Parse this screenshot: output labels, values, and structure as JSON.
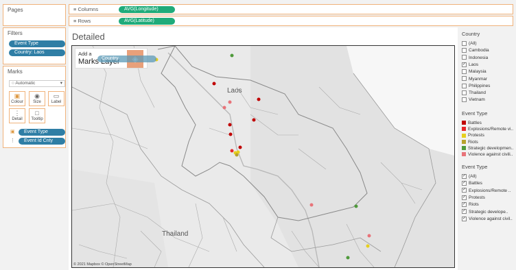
{
  "shelves": {
    "pages_label": "Pages",
    "columns_label": "Columns",
    "columns_pill": "AVG(Longitude)",
    "rows_label": "Rows",
    "rows_pill": "AVG(Latitude)"
  },
  "filters": {
    "title": "Filters",
    "items": [
      "Event Type",
      "Country: Laos"
    ]
  },
  "marks": {
    "title": "Marks",
    "type_value": "Automatic",
    "buttons": [
      "Colour",
      "Size",
      "Label",
      "Detail",
      "Tooltip"
    ],
    "fields": [
      "Event Type",
      "Event Id Cnty"
    ]
  },
  "view": {
    "title": "Detailed",
    "add_layer_line1": "Add a",
    "add_layer_line2": "Marks Layer",
    "drag_pill": "Country",
    "label_laos": "Laos",
    "label_thailand": "Thailand",
    "attribution": "© 2021 Mapbox © OpenStreetMap"
  },
  "country_filter": {
    "title": "Country",
    "items": [
      {
        "label": "(All)",
        "checked": false
      },
      {
        "label": "Cambodia",
        "checked": false
      },
      {
        "label": "Indonesia",
        "checked": false
      },
      {
        "label": "Laos",
        "checked": true
      },
      {
        "label": "Malaysia",
        "checked": false
      },
      {
        "label": "Myanmar",
        "checked": false
      },
      {
        "label": "Philippines",
        "checked": false
      },
      {
        "label": "Thailand",
        "checked": false
      },
      {
        "label": "Vietnam",
        "checked": false
      }
    ]
  },
  "event_legend": {
    "title": "Event Type",
    "items": [
      {
        "label": "Battles",
        "color": "#c00000"
      },
      {
        "label": "Explosions/Remote vi..",
        "color": "#e8262a"
      },
      {
        "label": "Protests",
        "color": "#e6cf1d"
      },
      {
        "label": "Riots",
        "color": "#b8a22c"
      },
      {
        "label": "Strategic developmen..",
        "color": "#4f9a3b"
      },
      {
        "label": "Violence against civili..",
        "color": "#e8747a"
      }
    ]
  },
  "event_filter": {
    "title": "Event Type",
    "items": [
      {
        "label": "(All)",
        "checked": true
      },
      {
        "label": "Battles",
        "checked": true
      },
      {
        "label": "Explosions/Remote ..",
        "checked": true
      },
      {
        "label": "Protests",
        "checked": true
      },
      {
        "label": "Riots",
        "checked": true
      },
      {
        "label": "Strategic develope..",
        "checked": true
      },
      {
        "label": "Violence against civil..",
        "checked": true
      }
    ]
  },
  "map_points": [
    {
      "type": "Strategic developments",
      "color": "#4f9a3b"
    },
    {
      "type": "Protests",
      "color": "#e6cf1d"
    },
    {
      "type": "Battles",
      "color": "#c00000"
    },
    {
      "type": "Violence against civilians",
      "color": "#e8747a"
    },
    {
      "type": "Battles",
      "color": "#c00000"
    },
    {
      "type": "Violence against civilians",
      "color": "#e8747a"
    },
    {
      "type": "Battles",
      "color": "#c00000"
    },
    {
      "type": "Battles",
      "color": "#c00000"
    },
    {
      "type": "Battles",
      "color": "#c00000"
    },
    {
      "type": "Battles",
      "color": "#c00000"
    },
    {
      "type": "Explosions/Remote violence",
      "color": "#e8262a"
    },
    {
      "type": "Protests",
      "color": "#e6cf1d"
    },
    {
      "type": "Protests",
      "color": "#e6cf1d"
    },
    {
      "type": "Riots",
      "color": "#b8a22c"
    },
    {
      "type": "Violence against civilians",
      "color": "#e8747a"
    },
    {
      "type": "Strategic developments",
      "color": "#4f9a3b"
    },
    {
      "type": "Violence against civilians",
      "color": "#e8747a"
    },
    {
      "type": "Protests",
      "color": "#e6cf1d"
    },
    {
      "type": "Strategic developments",
      "color": "#4f9a3b"
    }
  ]
}
